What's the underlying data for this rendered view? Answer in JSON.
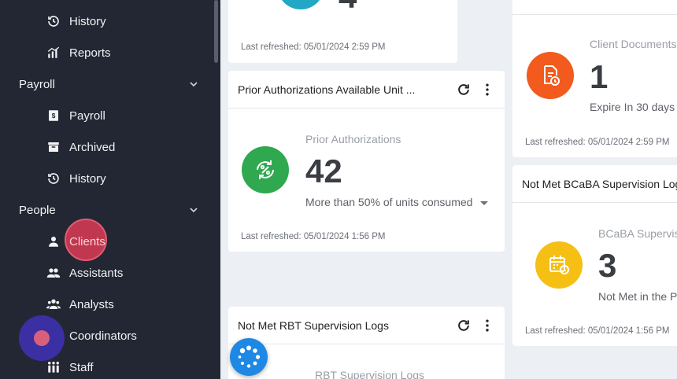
{
  "sidebar": {
    "items": [
      {
        "label": "History",
        "icon": "history-icon"
      },
      {
        "label": "Reports",
        "icon": "reports-icon"
      },
      {
        "label": "Payroll",
        "icon": "payroll-icon"
      },
      {
        "label": "Archived",
        "icon": "archive-icon"
      },
      {
        "label": "History",
        "icon": "history-icon"
      },
      {
        "label": "Clients",
        "icon": "person-icon"
      },
      {
        "label": "Assistants",
        "icon": "assistants-icon"
      },
      {
        "label": "Analysts",
        "icon": "analysts-icon"
      },
      {
        "label": "Coordinators",
        "icon": "coordinators-icon"
      },
      {
        "label": "Staff",
        "icon": "staff-icon"
      }
    ],
    "sections": [
      {
        "label": "Payroll"
      },
      {
        "label": "People"
      }
    ]
  },
  "cards": {
    "top_left": {
      "value": "4",
      "refreshed": "Last refreshed: 05/01/2024 2:59 PM"
    },
    "prior_auth": {
      "title": "Prior Authorizations Available Unit ...",
      "label": "Prior Authorizations",
      "value": "42",
      "sub": "More than 50% of units consumed",
      "refreshed": "Last refreshed: 05/01/2024 1:56 PM",
      "color": "#2fa84f"
    },
    "rbt": {
      "title": "Not Met RBT Supervision Logs",
      "label": "RBT Supervision Logs"
    },
    "client_docs": {
      "label": "Client Documents",
      "value": "1",
      "sub": "Expire In 30 days o",
      "refreshed": "Last refreshed: 05/01/2024 2:59 PM",
      "color": "#f25a1e"
    },
    "bcaba": {
      "title": "Not Met BCaBA Supervision Logs",
      "label": "BCaBA Supervisi",
      "value": "3",
      "sub": "Not Met in the Pr",
      "refreshed": "Last refreshed: 05/01/2024 1:56 PM",
      "color": "#f5bf14"
    }
  }
}
